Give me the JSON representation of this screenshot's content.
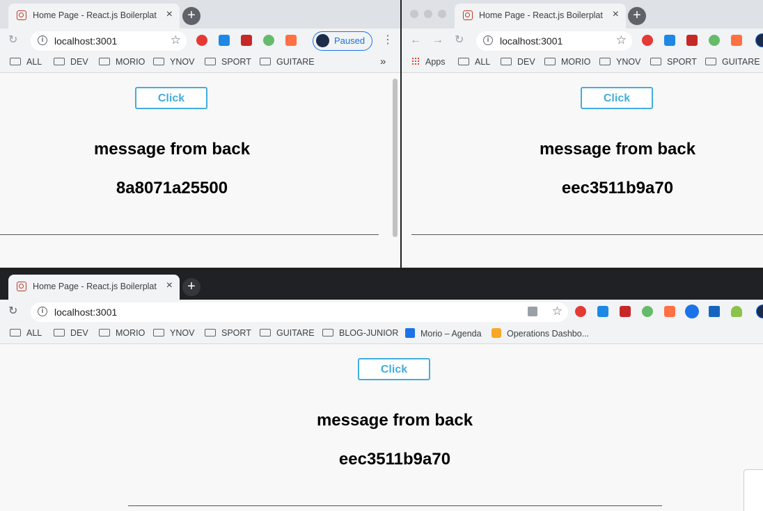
{
  "windows": {
    "topleft": {
      "tab_title": "Home Page - React.js Boilerplate",
      "url": "localhost:3001",
      "paused_label": "Paused",
      "bookmarks": [
        "ALL",
        "DEV",
        "MORIO",
        "YNOV",
        "SPORT",
        "GUITARE"
      ],
      "more": "»",
      "button_label": "Click",
      "heading": "message from back",
      "message": "8a8071a25500"
    },
    "topright": {
      "tab_title": "Home Page - React.js Boilerplate",
      "url": "localhost:3001",
      "apps_label": "Apps",
      "bookmarks": [
        "ALL",
        "DEV",
        "MORIO",
        "YNOV",
        "SPORT",
        "GUITARE"
      ],
      "button_label": "Click",
      "heading": "message from back",
      "message": "eec3511b9a70"
    },
    "bottom": {
      "tab_title": "Home Page - React.js Boilerplate",
      "url": "localhost:3001",
      "bookmarks": [
        "ALL",
        "DEV",
        "MORIO",
        "YNOV",
        "SPORT",
        "GUITARE",
        "BLOG-JUNIOR"
      ],
      "bookmark_agenda": "Morio – Agenda",
      "bookmark_ops": "Operations Dashbo...",
      "button_label": "Click",
      "heading": "message from back",
      "message": "eec3511b9a70"
    }
  },
  "colors": {
    "accent": "#41addd",
    "tab_bg": "#f1f3f4",
    "tabstrip_light": "#dee1e6",
    "tabstrip_dark": "#202124"
  },
  "icons": [
    "reload-icon",
    "back-icon",
    "forward-icon",
    "info-icon",
    "star-icon",
    "folder-icon",
    "close-icon",
    "plus-icon",
    "menu-icon",
    "translate-icon",
    "calendar-icon"
  ]
}
